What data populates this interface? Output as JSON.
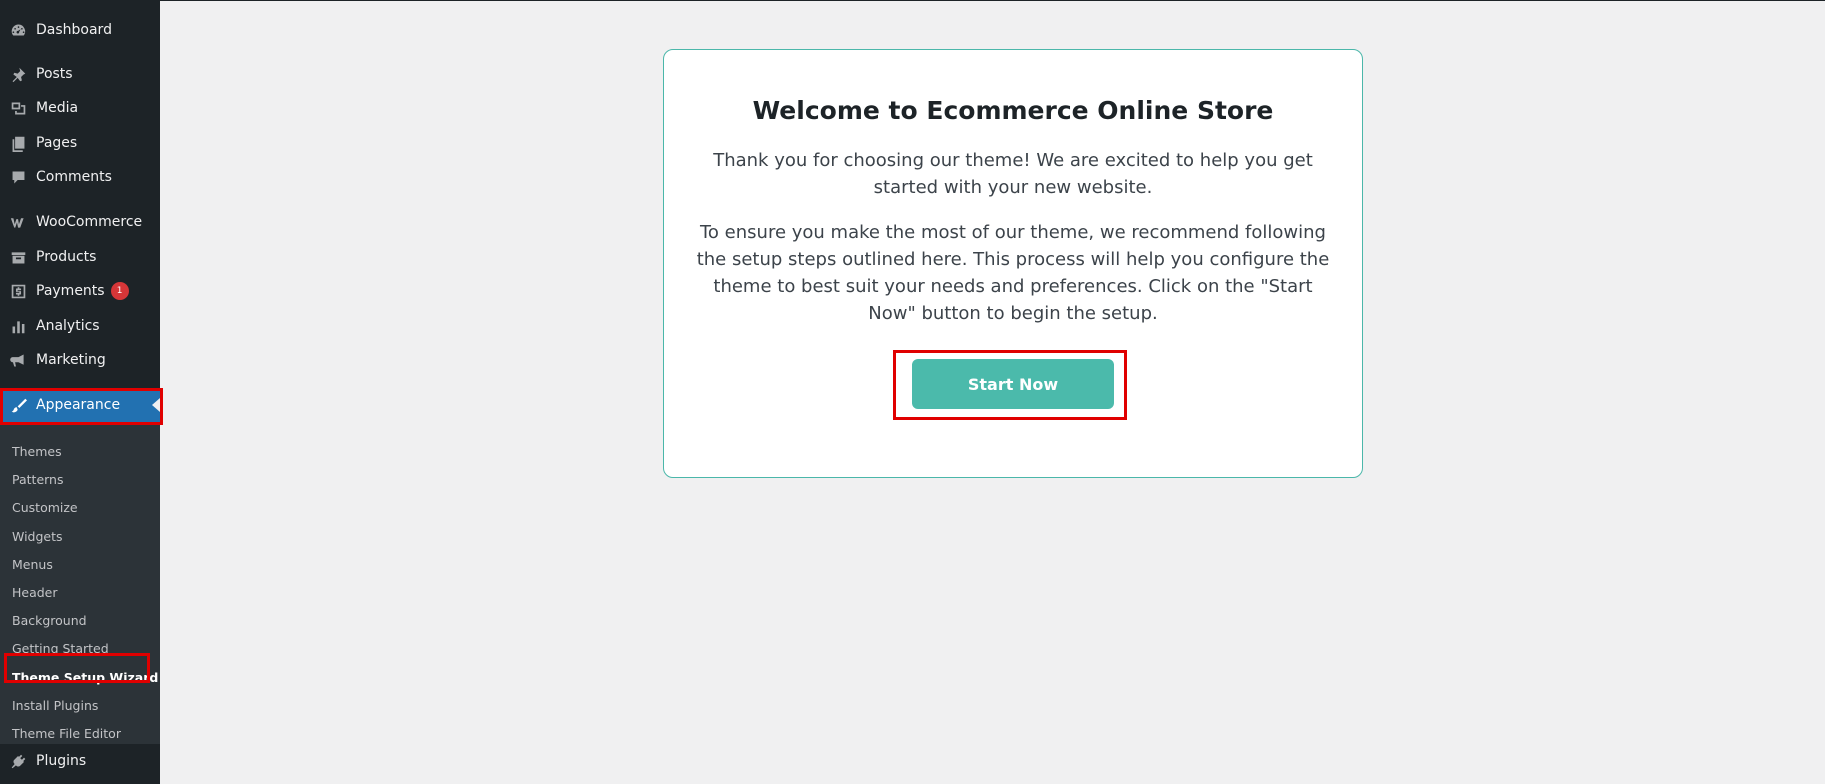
{
  "sidebar": {
    "items": [
      {
        "label": "Dashboard",
        "icon": "dashboard-icon"
      },
      {
        "label": "Posts",
        "icon": "pin-icon"
      },
      {
        "label": "Media",
        "icon": "media-icon"
      },
      {
        "label": "Pages",
        "icon": "pages-icon"
      },
      {
        "label": "Comments",
        "icon": "comment-icon"
      },
      {
        "label": "WooCommerce",
        "icon": "woo-icon"
      },
      {
        "label": "Products",
        "icon": "archive-icon"
      },
      {
        "label": "Payments",
        "icon": "payments-icon",
        "badge": "1"
      },
      {
        "label": "Analytics",
        "icon": "bar-chart-icon"
      },
      {
        "label": "Marketing",
        "icon": "megaphone-icon"
      },
      {
        "label": "Appearance",
        "icon": "brush-icon",
        "current": true
      },
      {
        "label": "Plugins",
        "icon": "plug-icon"
      }
    ],
    "submenu": [
      "Themes",
      "Patterns",
      "Customize",
      "Widgets",
      "Menus",
      "Header",
      "Background",
      "Getting Started",
      "Theme Setup Wizard",
      "Install Plugins",
      "Theme File Editor"
    ]
  },
  "main": {
    "title": "Welcome to Ecommerce Online Store",
    "paragraph1": "Thank you for choosing our theme! We are excited to help you get started with your new website.",
    "paragraph2": "To ensure you make the most of our theme, we recommend following the setup steps outlined here. This process will help you configure the theme to best suit your needs and preferences. Click on the \"Start Now\" button to begin the setup.",
    "button_label": "Start Now"
  },
  "colors": {
    "sidebar_bg": "#1d2327",
    "submenu_bg": "#2c3338",
    "accent": "#2271b1",
    "button_bg": "#4bbaab",
    "highlight": "#e00000",
    "badge": "#d63638"
  }
}
